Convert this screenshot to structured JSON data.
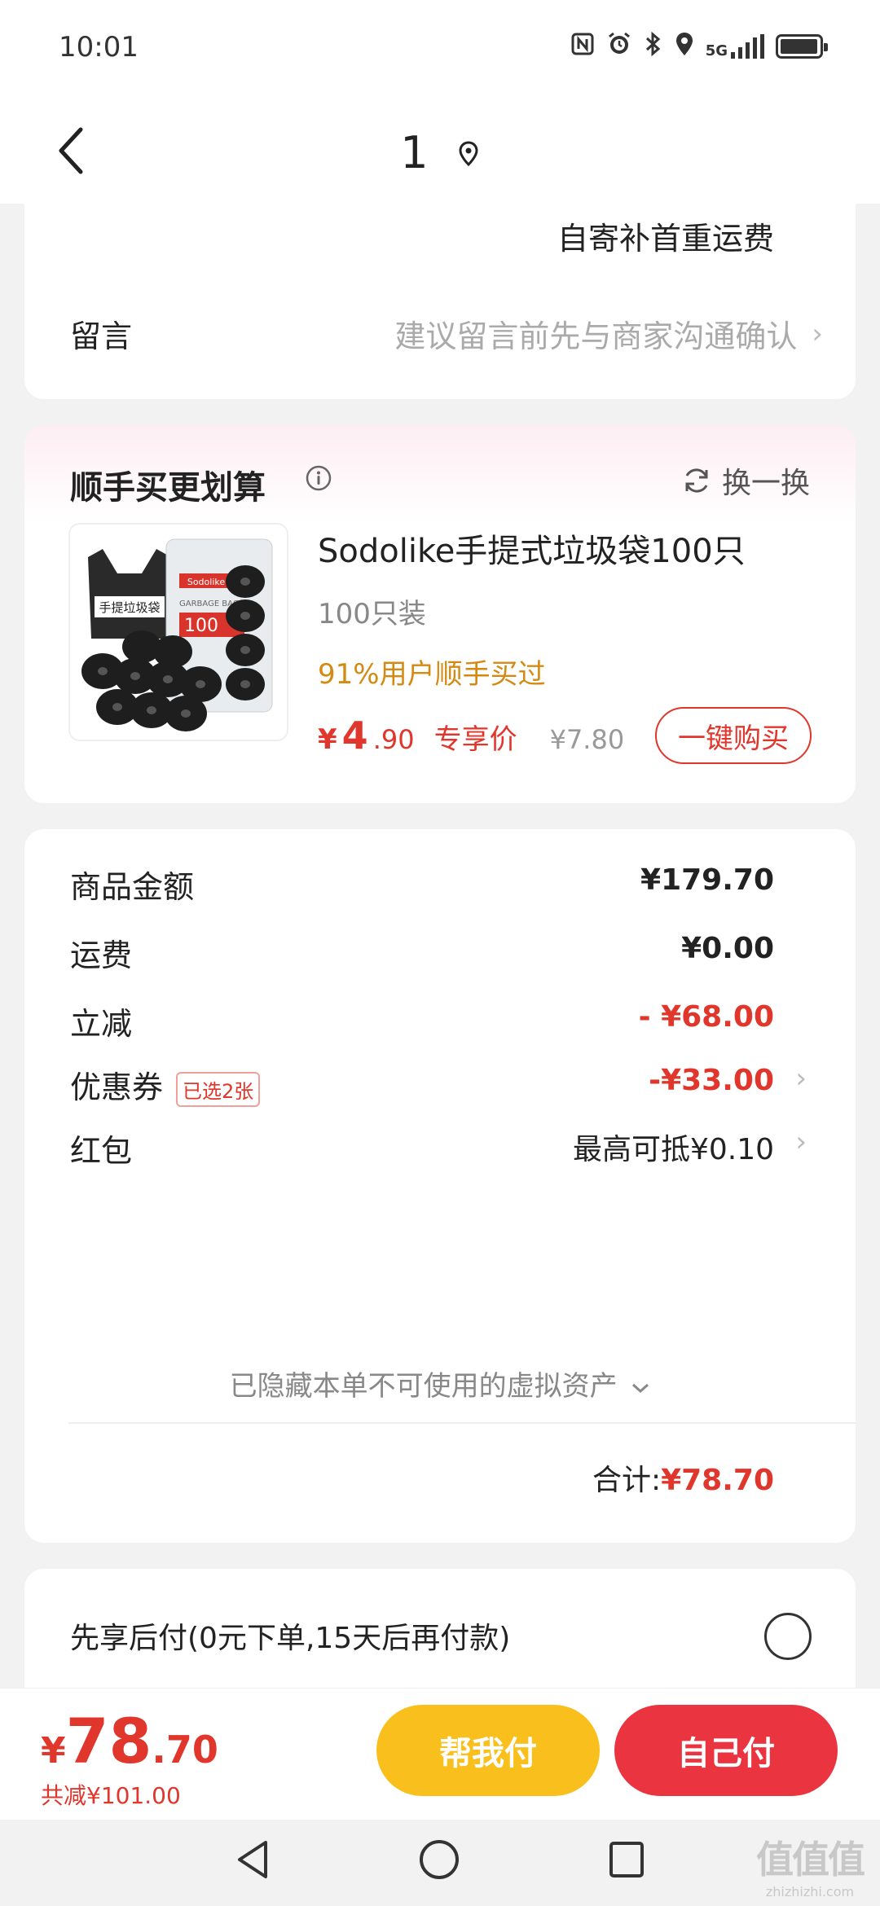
{
  "status_bar": {
    "time": "10:01",
    "network": "5G",
    "icons": [
      "nfc-icon",
      "alarm-icon",
      "bluetooth-icon",
      "location-icon",
      "signal-icon",
      "battery-icon"
    ]
  },
  "header": {
    "title": "1",
    "back_icon": "chevron-left-icon",
    "location_icon": "location-pin-icon"
  },
  "shipping": {
    "partial_text": "自寄补首重运费"
  },
  "message": {
    "label": "留言",
    "placeholder": "建议留言前先与商家沟通确认",
    "chevron": "›"
  },
  "addon": {
    "title": "顺手买更划算",
    "swap_label": "换一换",
    "product": {
      "name": "Sodolike手提式垃圾袋100只",
      "spec": "100只装",
      "rate": "91%用户顺手买过",
      "price_currency": "¥",
      "price_int": "4",
      "price_dec": ".90",
      "price_tag": "专享价",
      "original_price": "¥7.80",
      "buy_label": "一键购买",
      "image_text_top": "手提垃圾袋",
      "image_text_brand": "Sodolike",
      "image_text_count": "100",
      "image_text_bags": "GARBAGE BAGS"
    }
  },
  "summary": {
    "goods_label": "商品金额",
    "goods_value": "¥179.70",
    "freight_label": "运费",
    "freight_value": "¥0.00",
    "discount_label": "立减",
    "discount_value": "- ¥68.00",
    "coupon_label": "优惠券",
    "coupon_badge": "已选2张",
    "coupon_value": "-¥33.00",
    "redpacket_label": "红包",
    "redpacket_value": "最高可抵¥0.10",
    "hidden_note": "已隐藏本单不可使用的虚拟资产",
    "total_label": "合计:",
    "total_value": "¥78.70"
  },
  "paylater": {
    "label": "先享后付(0元下单,15天后再付款)"
  },
  "footer": {
    "currency": "¥",
    "amount_int": "78",
    "amount_dec": ".70",
    "saved": "共减¥101.00",
    "help_pay": "帮我付",
    "self_pay": "自己付"
  },
  "watermark": {
    "big": "值值值",
    "small": "zhizhizhi.com"
  },
  "colors": {
    "accent_red": "#e0362b",
    "help_yellow": "#f9c01d",
    "self_red": "#ea3440",
    "rate_orange": "#d48a12"
  }
}
